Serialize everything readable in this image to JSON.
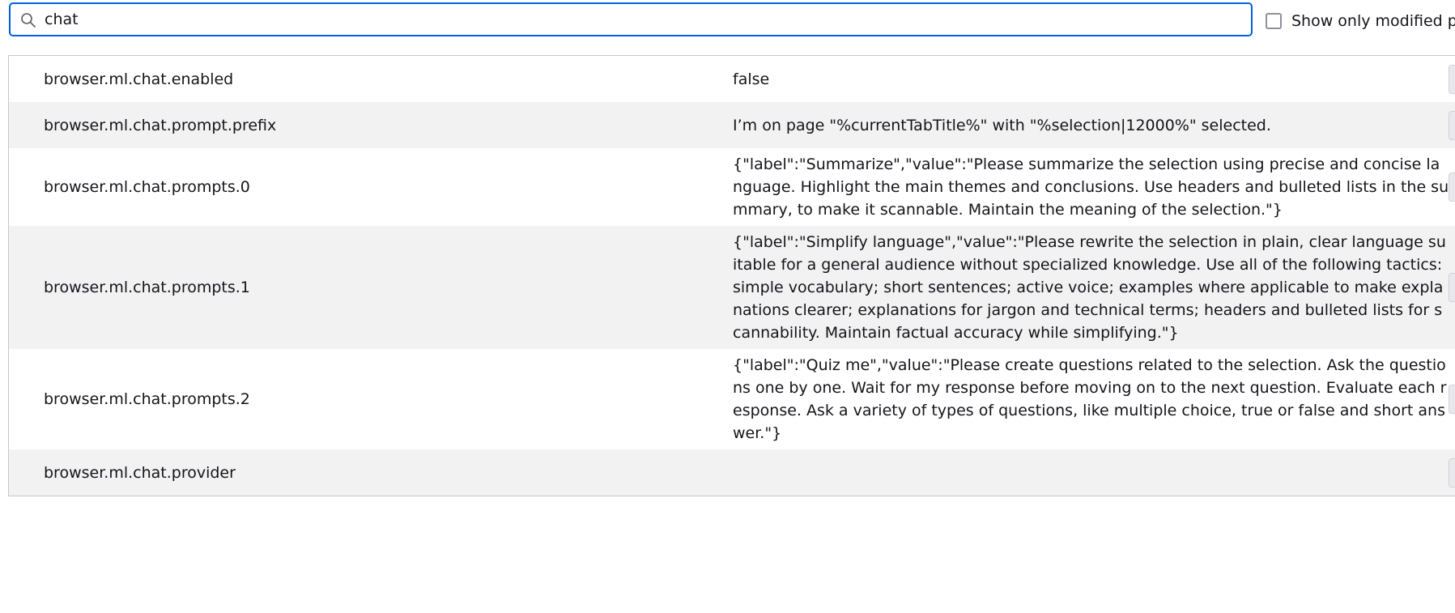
{
  "search": {
    "value": "chat",
    "icon": "search-icon"
  },
  "toggle": {
    "label": "Show only modified p"
  },
  "prefs": [
    {
      "name": "browser.ml.chat.enabled",
      "value": "false"
    },
    {
      "name": "browser.ml.chat.prompt.prefix",
      "value": "I’m on page \"%currentTabTitle%\" with \"%selection|12000%\" selected."
    },
    {
      "name": "browser.ml.chat.prompts.0",
      "value": "{\"label\":\"Summarize\",\"value\":\"Please summarize the selection using precise and concise language. Highlight the main themes and conclusions. Use headers and bulleted lists in the summary, to make it scannable. Maintain the meaning of the selection.\"}"
    },
    {
      "name": "browser.ml.chat.prompts.1",
      "value": "{\"label\":\"Simplify language\",\"value\":\"Please rewrite the selection in plain, clear language suitable for a general audience without specialized knowledge. Use all of the following tactics: simple vocabulary; short sentences; active voice; examples where applicable to make explanations clearer; explanations for jargon and technical terms; headers and bulleted lists for scannability. Maintain factual accuracy while simplifying.\"}"
    },
    {
      "name": "browser.ml.chat.prompts.2",
      "value": "{\"label\":\"Quiz me\",\"value\":\"Please create questions related to the selection. Ask the questions one by one. Wait for my response before moving on to the next question. Evaluate each response. Ask a variety of types of questions, like multiple choice, true or false and short answer.\"}"
    },
    {
      "name": "browser.ml.chat.provider",
      "value": ""
    }
  ]
}
